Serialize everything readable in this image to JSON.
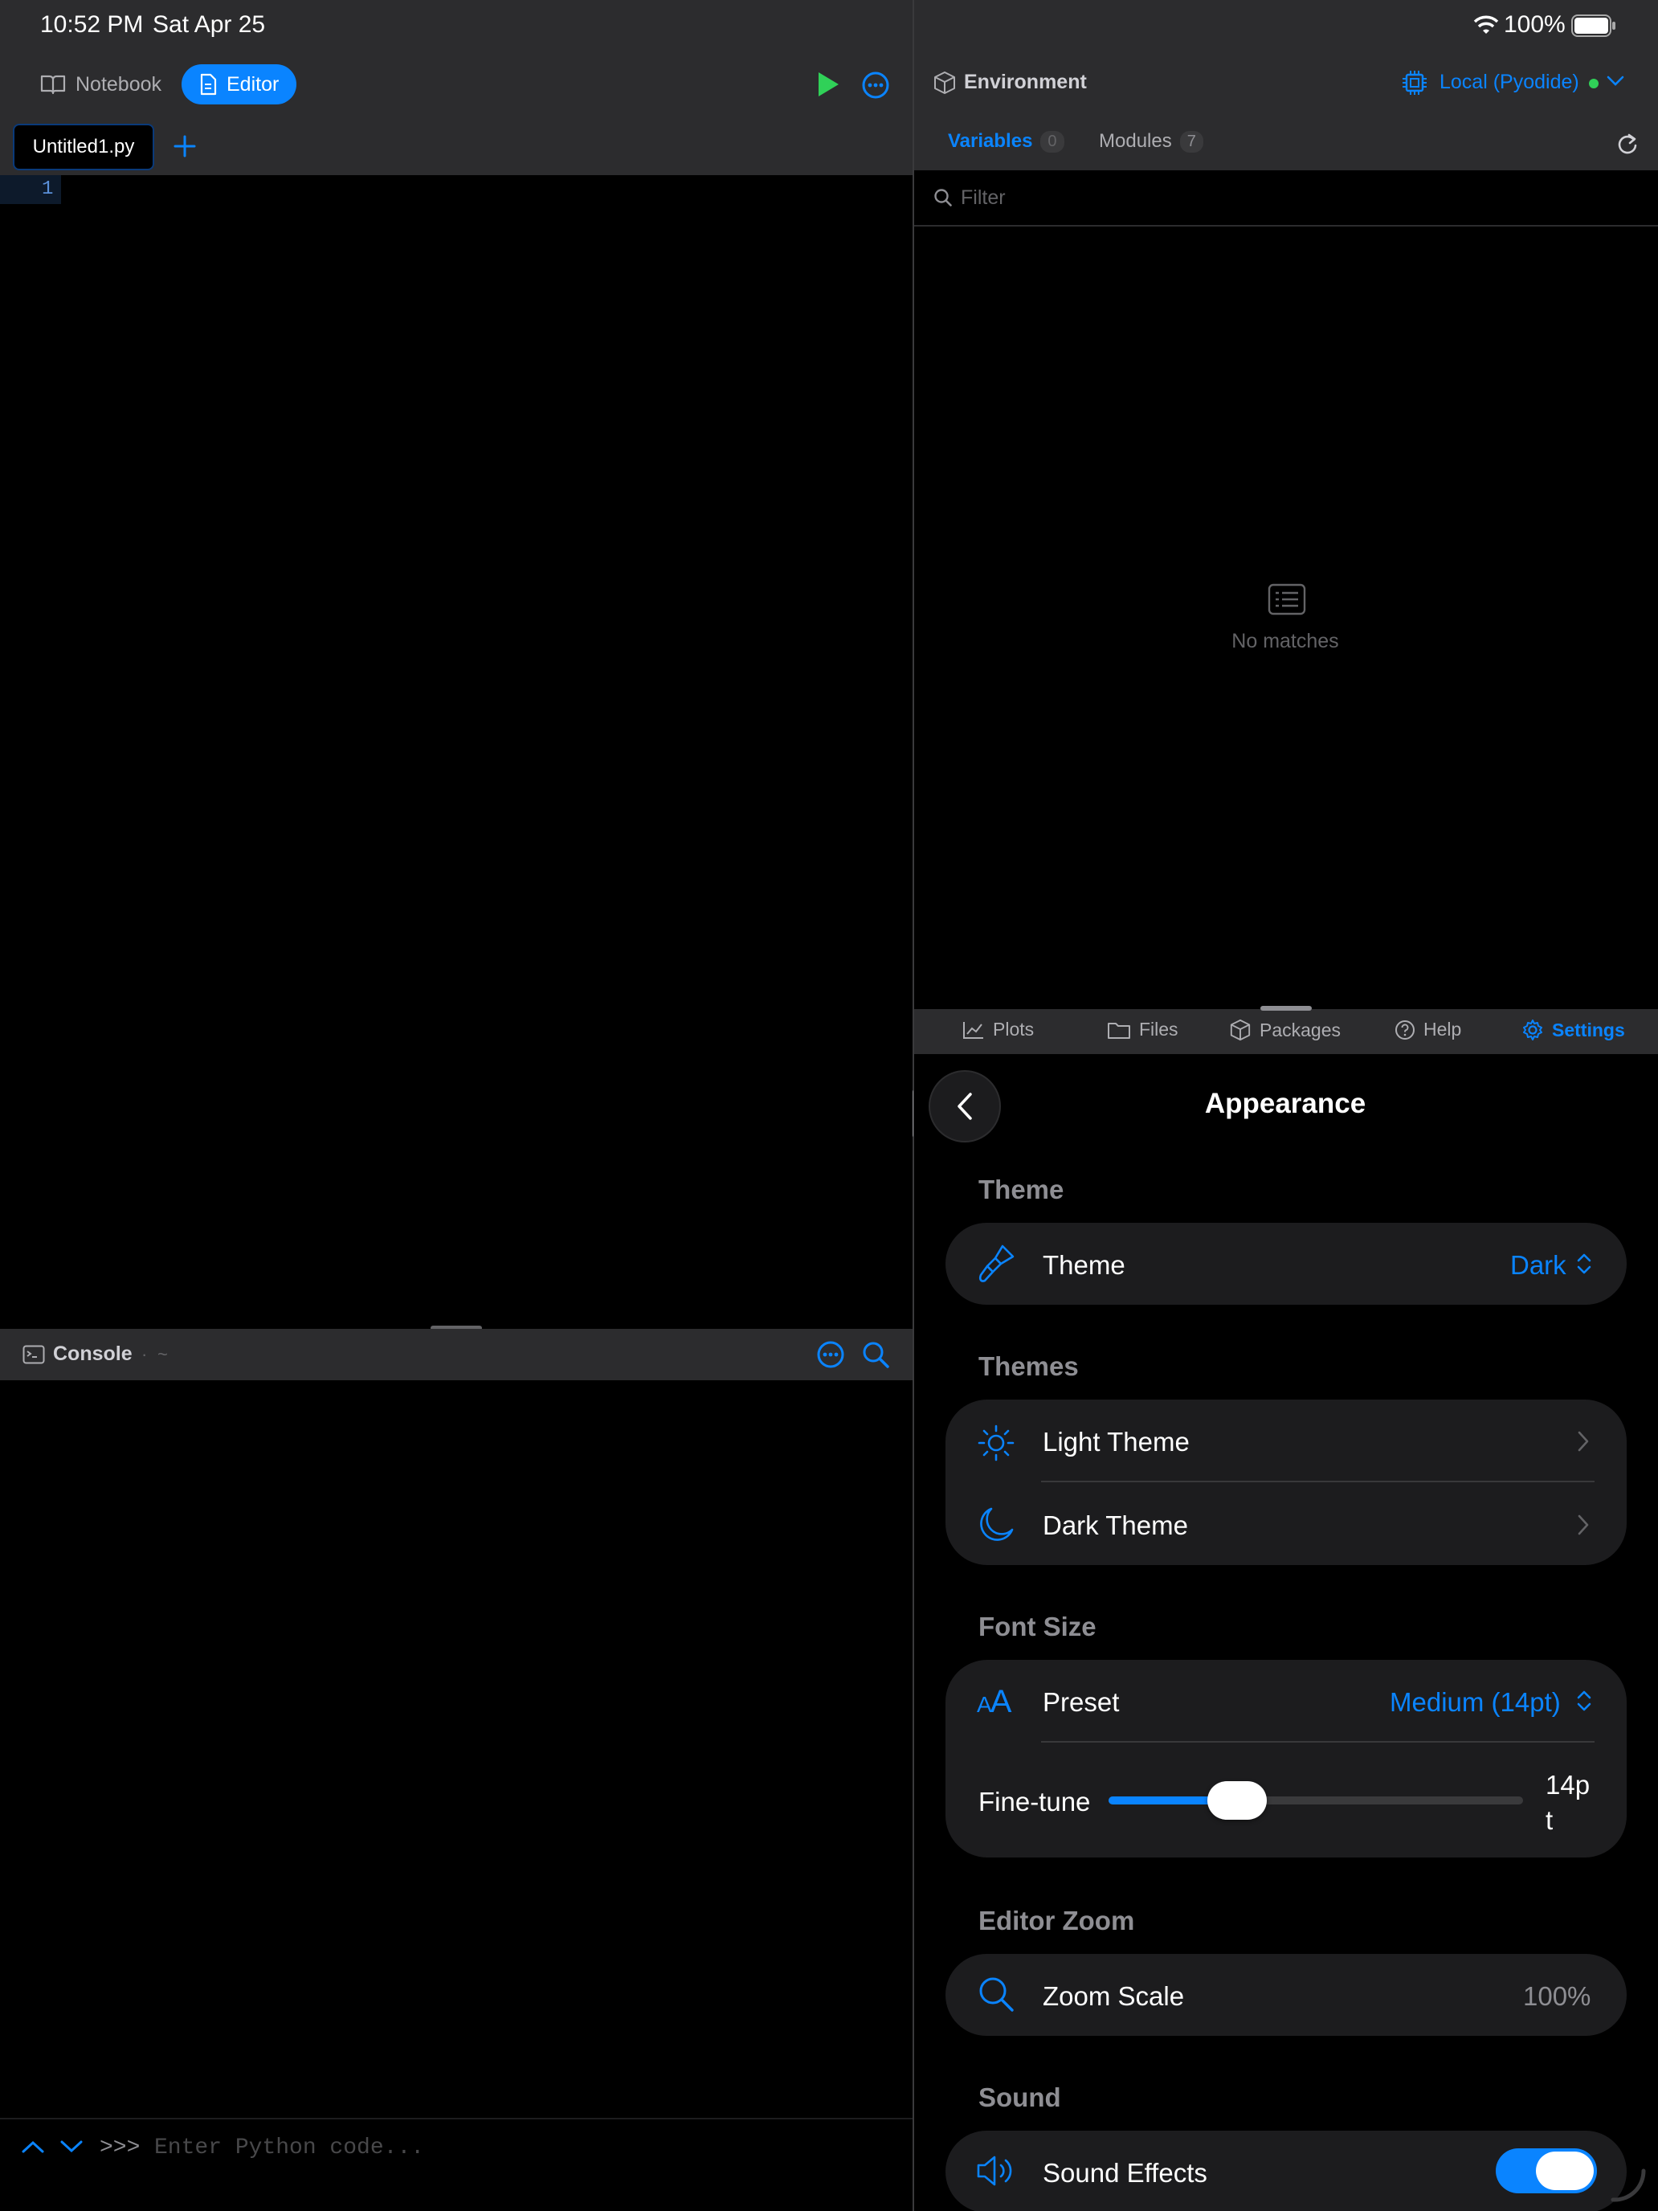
{
  "status_bar": {
    "time": "10:52 PM",
    "date": "Sat Apr 25",
    "battery": "100%"
  },
  "toolbar": {
    "notebook_label": "Notebook",
    "editor_label": "Editor"
  },
  "editor": {
    "tab_name": "Untitled1.py",
    "line_number": "1"
  },
  "environment": {
    "title": "Environment",
    "kernel": "Local (Pyodide)",
    "tabs": [
      {
        "label": "Variables",
        "count": "0"
      },
      {
        "label": "Modules",
        "count": "7"
      }
    ],
    "filter_placeholder": "Filter",
    "empty_text": "No matches"
  },
  "bottom_tabs": [
    "Plots",
    "Files",
    "Packages",
    "Help",
    "Settings"
  ],
  "console": {
    "title": "Console",
    "path": "~",
    "prompt": ">>>",
    "placeholder": "Enter Python code..."
  },
  "settings": {
    "page_title": "Appearance",
    "sections": {
      "theme": {
        "label": "Theme",
        "row_label": "Theme",
        "row_value": "Dark"
      },
      "themes": {
        "label": "Themes",
        "light": "Light Theme",
        "dark": "Dark Theme"
      },
      "font_size": {
        "label": "Font Size",
        "preset_label": "Preset",
        "preset_value": "Medium (14pt)",
        "finetune_label": "Fine-tune",
        "finetune_value_line1": "14p",
        "finetune_value_line2": "t",
        "slider_fraction": 0.31
      },
      "editor_zoom": {
        "label": "Editor Zoom",
        "row_label": "Zoom Scale",
        "row_value": "100%"
      },
      "sound": {
        "label": "Sound",
        "row_label": "Sound Effects",
        "enabled": true
      }
    }
  },
  "colors": {
    "accent": "#0a84ff",
    "run": "#30d158",
    "panel": "#2c2c2e",
    "card": "#1c1c1e"
  }
}
